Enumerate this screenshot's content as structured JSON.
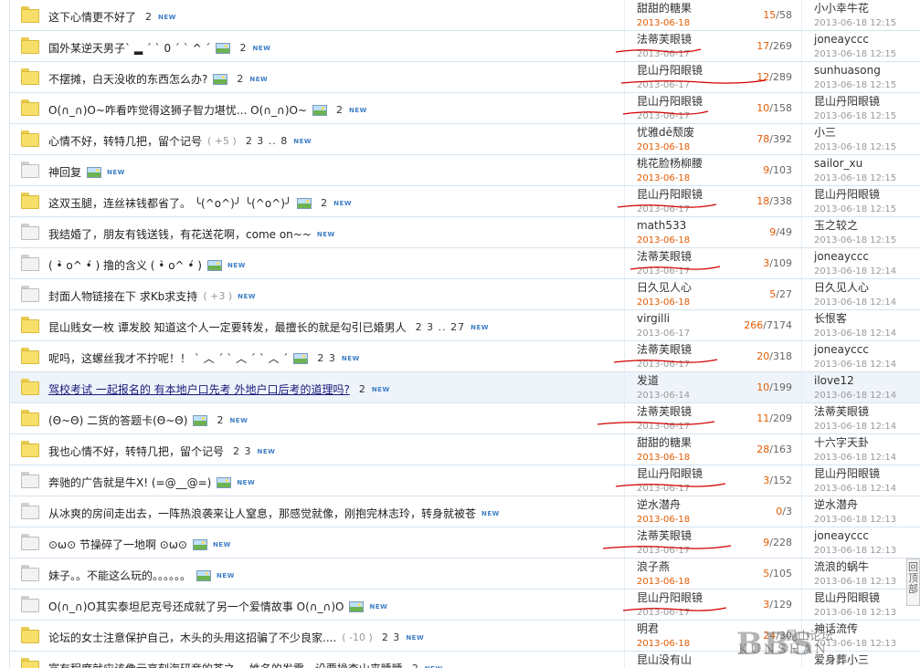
{
  "threads": [
    {
      "title": "这下心情更不好了",
      "pages": "2",
      "img": false,
      "extra": "",
      "author": "甜甜的糖果",
      "date": "2013-06-18",
      "date_gray": false,
      "replies": "15",
      "views": "58",
      "last_user": "小小幸牛花",
      "last_time": "2013-06-18 12:15",
      "folder": "yellow"
    },
    {
      "title": "国外某逆天男子` ▂ ´ ` 0 ´ ` ^ ´",
      "pages": "2",
      "img": true,
      "extra": "",
      "author": "法蒂芙眼镜",
      "date": "2013-06-17",
      "date_gray": true,
      "replies": "17",
      "views": "269",
      "last_user": "joneayccc",
      "last_time": "2013-06-18 12:15",
      "folder": "yellow"
    },
    {
      "title": "不摆摊，白天没收的东西怎么办?",
      "pages": "2",
      "img": true,
      "extra": "",
      "author": "昆山丹阳眼镜",
      "date": "2013-06-17",
      "date_gray": true,
      "replies": "12",
      "views": "289",
      "last_user": "sunhuasong",
      "last_time": "2013-06-18 12:15",
      "folder": "yellow"
    },
    {
      "title": "O(∩_∩)O~咋看咋觉得这狮子智力堪忧... O(∩_∩)O~",
      "pages": "2",
      "img": true,
      "extra": "",
      "author": "昆山丹阳眼镜",
      "date": "2013-06-17",
      "date_gray": true,
      "replies": "10",
      "views": "158",
      "last_user": "昆山丹阳眼镜",
      "last_time": "2013-06-18 12:15",
      "folder": "yellow"
    },
    {
      "title": "心情不好，转特几把，留个记号",
      "pages": "2 3 .. 8",
      "img": false,
      "extra": "( +5 )",
      "author": "忧雅dē颓废",
      "date": "2013-06-18",
      "date_gray": false,
      "replies": "78",
      "views": "392",
      "last_user": "小三",
      "last_time": "2013-06-18 12:15",
      "folder": "yellow"
    },
    {
      "title": "神回复",
      "pages": "",
      "img": true,
      "extra": "",
      "author": "桃花脸杨柳腰",
      "date": "2013-06-18",
      "date_gray": false,
      "replies": "9",
      "views": "103",
      "last_user": "sailor_xu",
      "last_time": "2013-06-18 12:15",
      "folder": "gray"
    },
    {
      "title": "这双玉腿，连丝袜钱都省了。 ╰(^o^)╯ ╰(^o^)╯",
      "pages": "2",
      "img": true,
      "extra": "",
      "author": "昆山丹阳眼镜",
      "date": "2013-06-17",
      "date_gray": true,
      "replies": "18",
      "views": "338",
      "last_user": "昆山丹阳眼镜",
      "last_time": "2013-06-18 12:15",
      "folder": "yellow"
    },
    {
      "title": "我结婚了，朋友有钱送钱，有花送花啊，come on~~",
      "pages": "",
      "img": false,
      "extra": "",
      "author": "math533",
      "date": "2013-06-18",
      "date_gray": false,
      "replies": "9",
      "views": "49",
      "last_user": "玉之较之",
      "last_time": "2013-06-18 12:15",
      "folder": "gray"
    },
    {
      "title": "( •̀ o^ •́ ) 撸的含义 ( •̀ o^ •́ )",
      "pages": "",
      "img": true,
      "extra": "",
      "author": "法蒂芙眼镜",
      "date": "2013-06-17",
      "date_gray": true,
      "replies": "3",
      "views": "109",
      "last_user": "joneayccc",
      "last_time": "2013-06-18 12:14",
      "folder": "gray"
    },
    {
      "title": "封面人物链接在下 求Kb求支持",
      "pages": "",
      "img": false,
      "extra": "( +3 )",
      "author": "日久见人心",
      "date": "2013-06-18",
      "date_gray": false,
      "replies": "5",
      "views": "27",
      "last_user": "日久见人心",
      "last_time": "2013-06-18 12:14",
      "folder": "gray"
    },
    {
      "title": "昆山贱女一枚 谭发胶 知道这个人一定要转发，最擅长的就是勾引已婚男人",
      "pages": "2 3 .. 27",
      "img": false,
      "extra": "",
      "author": "virgilli",
      "date": "2013-06-17",
      "date_gray": true,
      "replies": "266",
      "views": "7174",
      "last_user": "长恨客",
      "last_time": "2013-06-18 12:14",
      "folder": "yellow"
    },
    {
      "title": "呢吗，这螺丝我才不拧呢！！ ` ︿ ´ ` ︿ ´ ` ︿ ´",
      "pages": "2 3",
      "img": true,
      "extra": "",
      "author": "法蒂芙眼镜",
      "date": "2013-06-17",
      "date_gray": true,
      "replies": "20",
      "views": "318",
      "last_user": "joneayccc",
      "last_time": "2013-06-18 12:14",
      "folder": "yellow"
    },
    {
      "title": "驾校考试 一起报名的 有本地户口先考 外地户口后考的道理吗?",
      "pages": "2",
      "img": false,
      "extra": "",
      "author": "发道",
      "date": "2013-06-14",
      "date_gray": true,
      "replies": "10",
      "views": "199",
      "last_user": "ilove12",
      "last_time": "2013-06-18 12:14",
      "folder": "yellow",
      "link": true,
      "highlight": true
    },
    {
      "title": "(Θ~Θ) 二货的答题卡(Θ~Θ)",
      "pages": "2",
      "img": true,
      "extra": "",
      "author": "法蒂芙眼镜",
      "date": "2013-06-17",
      "date_gray": true,
      "replies": "11",
      "views": "209",
      "last_user": "法蒂芙眼镜",
      "last_time": "2013-06-18 12:14",
      "folder": "yellow"
    },
    {
      "title": "我也心情不好，转特几把，留个记号",
      "pages": "2 3",
      "img": false,
      "extra": "",
      "author": "甜甜的糖果",
      "date": "2013-06-18",
      "date_gray": false,
      "replies": "28",
      "views": "163",
      "last_user": "十六字天卦",
      "last_time": "2013-06-18 12:14",
      "folder": "yellow"
    },
    {
      "title": "奔驰的广告就是牛X! (=@__@=)",
      "pages": "",
      "img": true,
      "extra": "",
      "author": "昆山丹阳眼镜",
      "date": "2013-06-17",
      "date_gray": true,
      "replies": "3",
      "views": "152",
      "last_user": "昆山丹阳眼镜",
      "last_time": "2013-06-18 12:14",
      "folder": "gray"
    },
    {
      "title": "从冰爽的房间走出去，一阵热浪袭来让人窒息，那感觉就像，刚抱完林志玲，转身就被苍",
      "pages": "",
      "img": false,
      "extra": "",
      "author": "逆水潜舟",
      "date": "2013-06-18",
      "date_gray": false,
      "replies": "0",
      "views": "3",
      "last_user": "逆水潜舟",
      "last_time": "2013-06-18 12:13",
      "folder": "gray"
    },
    {
      "title": "⊙ω⊙ 节操碎了一地啊 ⊙ω⊙",
      "pages": "",
      "img": true,
      "extra": "",
      "author": "法蒂芙眼镜",
      "date": "2013-06-17",
      "date_gray": true,
      "replies": "9",
      "views": "228",
      "last_user": "joneayccc",
      "last_time": "2013-06-18 12:13",
      "folder": "gray"
    },
    {
      "title": "妹子。。不能这么玩的。。。。。。",
      "pages": "",
      "img": true,
      "extra": "",
      "author": "浪子燕",
      "date": "2013-06-18",
      "date_gray": false,
      "replies": "5",
      "views": "105",
      "last_user": "流浪的蜗牛",
      "last_time": "2013-06-18 12:13",
      "folder": "gray"
    },
    {
      "title": "O(∩_∩)O其实泰坦尼克号还成就了另一个爱情故事 O(∩_∩)O",
      "pages": "",
      "img": true,
      "extra": "",
      "author": "昆山丹阳眼镜",
      "date": "2013-06-17",
      "date_gray": true,
      "replies": "3",
      "views": "129",
      "last_user": "昆山丹阳眼镜",
      "last_time": "2013-06-18 12:13",
      "folder": "gray"
    },
    {
      "title": "论坛的女士注意保护自己，木头的头用这招骗了不少良家....",
      "pages": "2 3",
      "img": false,
      "extra": "( -10 )",
      "author": "明君",
      "date": "2013-06-18",
      "date_gray": false,
      "replies": "24",
      "views": "30",
      "last_user": "神话流传",
      "last_time": "2013-06-18 12:13",
      "folder": "yellow"
    },
    {
      "title": "富有程度就应该像元高刻海研竞的苍之一 姓名的发需，设要操查山来睡睡",
      "pages": "2",
      "img": false,
      "extra": "",
      "author": "昆山没有山",
      "date": "",
      "date_gray": false,
      "replies": "",
      "views": "",
      "last_user": "爱身葬小三",
      "last_time": "",
      "folder": "yellow"
    }
  ],
  "new_badge_text": "NEW",
  "back_to_top": "回顶部",
  "watermark": {
    "big": "BBS",
    "small": "KUNSHAN",
    "cn": "昆山论坛"
  },
  "colors": {
    "replies": "#e45a00",
    "date": "#e45a00",
    "border": "#d6e4ef",
    "highlight_row": "#eef4fa",
    "annotation": "#d40000"
  }
}
